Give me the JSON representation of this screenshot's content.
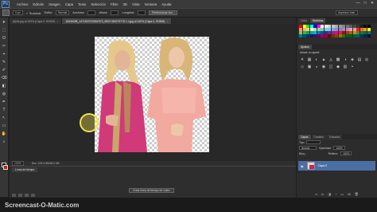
{
  "app": {
    "logo": "Ps"
  },
  "menu": {
    "items": [
      "Archivo",
      "Edición",
      "Imagen",
      "Capa",
      "Texto",
      "Selección",
      "Filtro",
      "3D",
      "Vista",
      "Ventana",
      "Ayuda"
    ]
  },
  "window_controls": [
    "—",
    "□",
    "✕"
  ],
  "options": {
    "px_value": "0 px",
    "suavizar_label": "✓ Suavizar",
    "estilo_label": "Estilo:",
    "estilo_value": "Normal",
    "anchura_label": "Anchura:",
    "altura_label": "Altura:",
    "longitud_label": "Longitud:",
    "refine_button": "Perfeccionar bor...",
    "workspace": "Aspectos bási..."
  },
  "tabs": [
    {
      "label": "jbjvifs.jpg al 100% (Capa 0, RGB/8)",
      "active": false
    },
    {
      "label": "10546298_1471519722962373_5903 050279778 1 n.jpg al 100% (Capa 0, RGB/8)",
      "active": true
    }
  ],
  "toolbar": {
    "tools": [
      "➤",
      "⬚",
      "ʘ",
      "✂",
      "⌖",
      "✎",
      "✐",
      "⌫",
      "◧",
      "◍",
      "✒",
      "T",
      "↖",
      "▭",
      "✋",
      "⌕"
    ]
  },
  "status": {
    "zoom": "100%",
    "doc_info": "Doc: 109,4 KB/45,0 KB"
  },
  "timeline": {
    "tab": "Línea de tiempo",
    "create_button": "Crear línea de tiempo de vídeo"
  },
  "right_panels": {
    "top_tabs": [
      {
        "label": "Color",
        "active": false
      },
      {
        "label": "Muestras",
        "active": true
      }
    ],
    "swatch_colors": [
      "#ff0000",
      "#ffff00",
      "#00ff00",
      "#00ffff",
      "#0000ff",
      "#ff00ff",
      "#ffffff",
      "#ebebeb",
      "#d6d6d6",
      "#c2c2c2",
      "#adadad",
      "#999999",
      "#858585",
      "#707070",
      "#5c5c5c",
      "#474747",
      "#333333",
      "#1f1f1f",
      "#0a0a0a",
      "#000000",
      "#f7977a",
      "#f9ad81",
      "#fdc68a",
      "#fff79a",
      "#c4df9b",
      "#a2d39c",
      "#82ca9d",
      "#7bcdc8",
      "#6ecff6",
      "#7ea7d8",
      "#8493ca",
      "#8882be",
      "#a187be",
      "#bc8dbf",
      "#f49ac2",
      "#f6989d",
      "#ed1c24",
      "#f26522",
      "#f7941d",
      "#fff200",
      "#8dc63f",
      "#39b54a",
      "#00a651",
      "#00a99d",
      "#00aeef",
      "#0072bc",
      "#0054a6",
      "#2e3192",
      "#662d91",
      "#92278f",
      "#ec008c",
      "#ed145b",
      "#9e0b0f",
      "#a0410d",
      "#a36209",
      "#aba000",
      "#598527",
      "#1a7b30",
      "#007236",
      "#00746b",
      "#0076a3",
      "#004b80",
      "#003471",
      "#1b1464",
      "#440e62",
      "#630460",
      "#9e005d",
      "#9e0039",
      "#790000",
      "#7b2e00",
      "#7d4900",
      "#827b00",
      "#406618",
      "#005e20",
      "#005826",
      "#005952",
      "#005b7f",
      "#003663",
      "#002157",
      "#0d004c"
    ],
    "adjustments": {
      "tab": "Ajustes",
      "heading": "Añadir un ajuste",
      "icons": [
        "☀",
        "▦",
        "◐",
        "▲",
        "◬",
        "▩",
        "◑",
        "◈",
        "▤",
        "◎",
        "◇",
        "▣",
        "◒",
        "◉",
        "◫",
        "◆",
        "▥",
        "◓"
      ]
    },
    "layers": {
      "tabs": [
        {
          "label": "Capas",
          "active": true
        },
        {
          "label": "Canales",
          "active": false
        },
        {
          "label": "Trazados",
          "active": false
        }
      ],
      "kind_label": "Tipo",
      "blend_mode": "Normal",
      "opacity_label": "Opacidad:",
      "opacity_value": "100%",
      "lock_label": "Bloq.:",
      "fill_label": "Relleno:",
      "fill_value": "100%",
      "layer_name": "Capa 0",
      "footer_icons": [
        "∞",
        "fx",
        "◨",
        "◔",
        "▭",
        "⊞",
        "🗑"
      ]
    }
  },
  "watermark": "Screencast-O-Matic.com"
}
